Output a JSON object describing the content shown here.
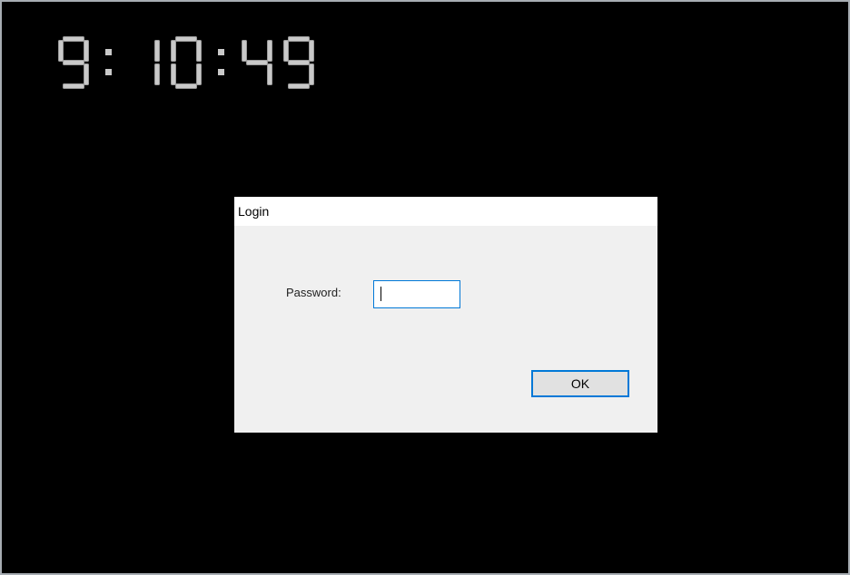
{
  "clock": {
    "time_text": "9:10:49",
    "digits": [
      "9",
      ":",
      "1",
      "0",
      ":",
      "4",
      "9"
    ]
  },
  "dialog": {
    "title": "Login",
    "password_label": "Password:",
    "password_value": "",
    "ok_label": "OK"
  },
  "colors": {
    "background": "#000000",
    "clock_digit": "#c9c9c9",
    "dialog_body": "#f0f0f0",
    "focus_accent": "#0078d7",
    "button_face": "#e1e1e1"
  }
}
